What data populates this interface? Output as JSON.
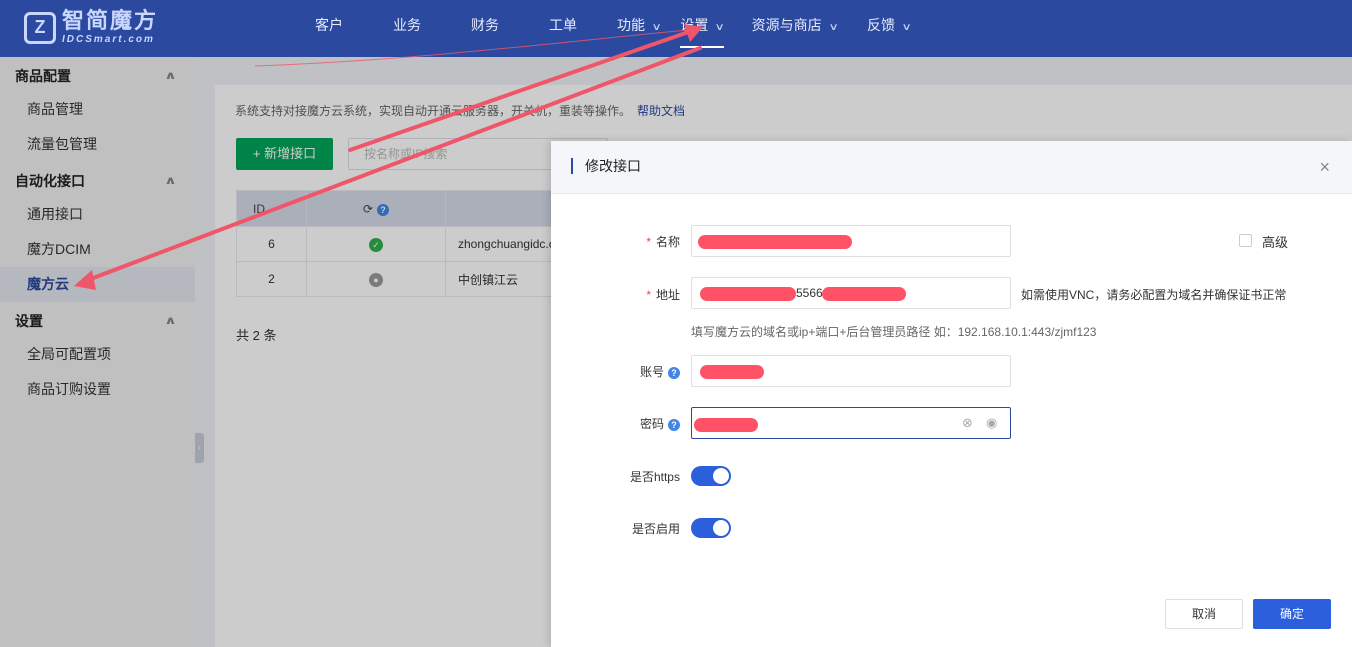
{
  "header": {
    "logo_cn": "智简魔方",
    "logo_en": "IDCSmart.com",
    "logo_mark": "Z",
    "nav": [
      {
        "label": "客户",
        "has_chevron": false
      },
      {
        "label": "业务",
        "has_chevron": false
      },
      {
        "label": "财务",
        "has_chevron": false
      },
      {
        "label": "工单",
        "has_chevron": false
      },
      {
        "label": "功能",
        "has_chevron": true
      },
      {
        "label": "设置",
        "has_chevron": true,
        "active": true
      },
      {
        "label": "资源与商店",
        "has_chevron": true
      },
      {
        "label": "反馈",
        "has_chevron": true
      }
    ],
    "chevron_icon": "chevron-down-icon"
  },
  "sidebar": {
    "groups": [
      {
        "label": "商品配置",
        "items": [
          "商品管理",
          "流量包管理"
        ]
      },
      {
        "label": "自动化接口",
        "items": [
          "通用接口",
          "魔方DCIM",
          "魔方云"
        ]
      },
      {
        "label": "设置",
        "items": [
          "全局可配置项",
          "商品订购设置"
        ]
      }
    ],
    "active_item": "魔方云",
    "collapse_glyph": "‹"
  },
  "main": {
    "intro": "系统支持对接魔方云系统，实现自动开通云服务器，开关机，重装等操作。",
    "help_link": "帮助文档",
    "add_button": "+ 新增接口",
    "search_placeholder": "按名称或IP搜索",
    "table": {
      "headers": {
        "id": "ID",
        "status": "⟳",
        "status_help": "?"
      },
      "rows": [
        {
          "id": "6",
          "status": "ok",
          "name": "zhongchuangidc.c"
        },
        {
          "id": "2",
          "status": "off",
          "name": "中创镇江云"
        }
      ]
    },
    "total": "共 2 条"
  },
  "dialog": {
    "title": "修改接口",
    "close_glyph": "×",
    "fields": {
      "name_label": "名称",
      "address_label": "地址",
      "address_visible_fragment": "5566",
      "address_hint_right": "如需使用VNC，请务必配置为域名并确保证书正常",
      "address_hint_below": "填写魔方云的域名或ip+端口+后台管理员路径 如：192.168.10.1:443/zjmf123",
      "account_label": "账号",
      "password_label": "密码",
      "https_label": "是否https",
      "enable_label": "是否启用",
      "advanced_label": "高级",
      "help_glyph": "?",
      "required_mark": "*"
    },
    "states": {
      "https": true,
      "enabled": true,
      "advanced": false
    },
    "cancel": "取消",
    "confirm": "确定"
  },
  "colors": {
    "header_bg": "#2b4a9f",
    "primary": "#2b5fdc",
    "add_button": "#00a65a",
    "annotation_arrow": "#f0566a",
    "redaction": "#ff5266"
  }
}
